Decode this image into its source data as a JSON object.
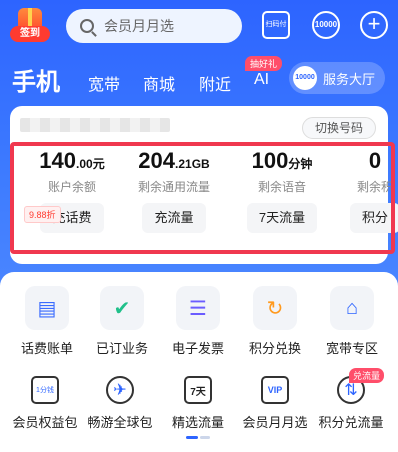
{
  "topbar": {
    "signin_label": "签到",
    "search_placeholder": "会员月月选",
    "scan_label": "扫码付",
    "ten_label": "10000"
  },
  "nav": {
    "tabs": [
      {
        "label": "手机",
        "active": true
      },
      {
        "label": "宽带"
      },
      {
        "label": "商城"
      },
      {
        "label": "附近"
      },
      {
        "label": "AI",
        "badge": "抽好礼"
      }
    ],
    "hall_label": "服务大厅",
    "hall_icon_text": "10000"
  },
  "account": {
    "switch_label": "切换号码",
    "stats": [
      {
        "value": "140",
        "unit": ".00元",
        "label": "账户余额",
        "action": "充话费",
        "tag": "9.88折"
      },
      {
        "value": "204",
        "unit": ".21GB",
        "label": "剩余通用流量",
        "action": "充流量"
      },
      {
        "value": "100",
        "unit": "分钟",
        "label": "剩余语音",
        "action": "7天流量"
      },
      {
        "value": "0",
        "unit": "",
        "label": "剩余积",
        "action": "积分"
      }
    ]
  },
  "services": {
    "row1": [
      "话费账单",
      "已订业务",
      "电子发票",
      "积分兑换",
      "宽带专区"
    ],
    "row2": [
      "会员权益包",
      "畅游全球包",
      "精选流量",
      "会员月月选",
      "积分兑流量"
    ],
    "row2_badge": "兑流量",
    "icon_texts": [
      "1分钱",
      "7天",
      "VIP"
    ]
  },
  "colors": {
    "primary": "#2d64ff",
    "highlight": "#f0384f",
    "badge": "#ff4e6a"
  }
}
